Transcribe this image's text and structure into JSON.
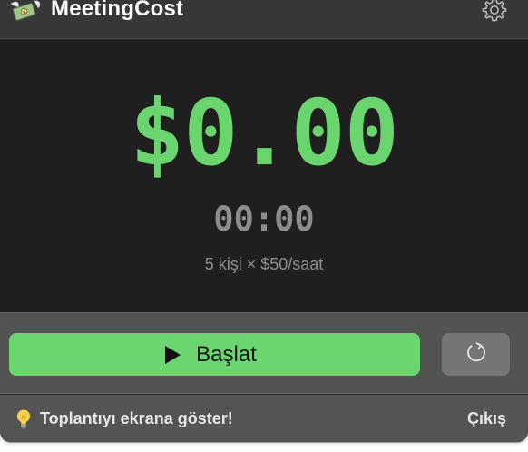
{
  "header": {
    "app_title": "MeetingCost",
    "app_icon": "money-with-wings-icon",
    "settings_icon": "gear-icon"
  },
  "display": {
    "cost": "$0.00",
    "timer": "00:00",
    "rate_info": "5 kişi × $50/saat"
  },
  "controls": {
    "start_label": "Başlat",
    "start_icon": "play-icon",
    "reset_icon": "reset-icon"
  },
  "footer": {
    "tip_icon": "lightbulb-icon",
    "tip_text": "Toplantıyı ekrana göster!",
    "quit_label": "Çıkış"
  },
  "colors": {
    "accent_green": "#6ad56f",
    "display_bg": "#1f1f1f",
    "panel_bg": "#535353"
  }
}
